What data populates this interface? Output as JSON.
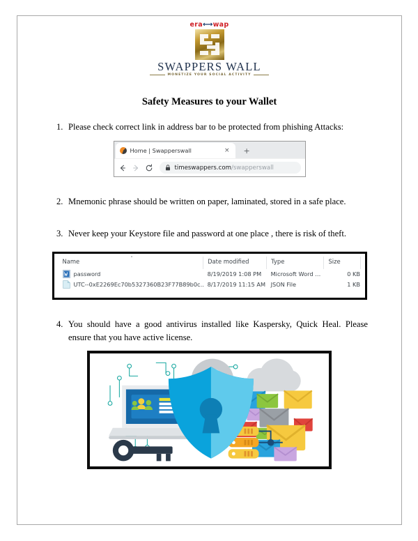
{
  "logo": {
    "era_part1": "era",
    "era_swap_glyph": "⟷",
    "era_part2": "wap",
    "brand": "SWAPPERS  WALL",
    "tagline": "MONETIZE YOUR SOCIAL ACTIVITY",
    "mark_colors": {
      "gold_light": "#f3e3a8",
      "gold_dark": "#7d5f12"
    }
  },
  "document": {
    "title": "Safety Measures to your Wallet",
    "items": [
      {
        "num": "1.",
        "text": "Please check correct link in address bar to be protected from phishing Attacks:"
      },
      {
        "num": "2.",
        "text": "Mnemonic phrase should be written on paper, laminated, stored in a safe place."
      },
      {
        "num": "3.",
        "text": "Never keep your Keystore file and password  at one place , there is risk of theft."
      },
      {
        "num": "4.",
        "text": "You should have a good antivirus installed like Kaspersky, Quick Heal. Please ensure that you have active license."
      }
    ]
  },
  "browser_screenshot": {
    "tab_title": "Home | Swapperswall",
    "tab_close_label": "×",
    "new_tab_label": "+",
    "back_icon": "back-arrow-icon",
    "forward_icon": "forward-arrow-icon",
    "reload_icon": "reload-icon",
    "lock_icon": "padlock-icon",
    "url_domain": "timeswappers.com",
    "url_path": "/swapperswall",
    "favicon_colors": {
      "orange": "#f08a24",
      "dark": "#3d3d3d"
    }
  },
  "file_explorer_screenshot": {
    "columns": [
      "Name",
      "Date modified",
      "Type",
      "Size"
    ],
    "sort_caret": "˄",
    "rows": [
      {
        "icon": "word-document-icon",
        "name": "password",
        "date_modified": "8/19/2019 1:08 PM",
        "type": "Microsoft Word D...",
        "size": "0 KB"
      },
      {
        "icon": "json-file-icon",
        "name": "UTC--0xE2269Ec70b5327360B23F77B89b0c...",
        "date_modified": "8/17/2019 11:15 AM",
        "type": "JSON File",
        "size": "1 KB"
      }
    ]
  },
  "illustration": {
    "alt": "cyber security shield illustration",
    "elements": [
      "shield-with-keyhole",
      "padlock",
      "laptop-with-user-profile",
      "key",
      "cloud",
      "envelopes",
      "servers",
      "circuit-lines"
    ],
    "colors": {
      "shield_light": "#4fc3e8",
      "shield_dark": "#0aa3dc",
      "padlock_gray": "#cfd3d6",
      "laptop_screen": "#1569a8",
      "key_navy": "#2b3a4a",
      "circuit_teal": "#17a7a0",
      "envelope_yellow": "#f6c93f",
      "envelope_blue": "#29a3dd",
      "server_orange": "#f5a623"
    }
  }
}
